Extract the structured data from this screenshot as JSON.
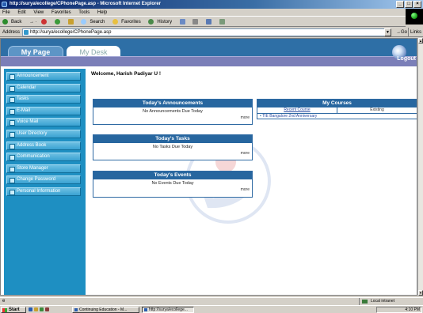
{
  "browser": {
    "title": "http://surya/ecollege/CPhonePage.asp - Microsoft Internet Explorer",
    "menu": [
      "File",
      "Edit",
      "View",
      "Favorites",
      "Tools",
      "Help"
    ],
    "toolbar": {
      "back": "Back",
      "search": "Search",
      "favorites": "Favorites",
      "history": "History"
    },
    "address_label": "Address",
    "address_url": "http://surya/ecollege/CPhonePage.asp",
    "go": "Go",
    "links": "Links"
  },
  "tabs": {
    "my_page": "My Page",
    "my_desk": "My Desk"
  },
  "logout": "Logout",
  "sidebar": {
    "items": [
      {
        "label": "Announcement"
      },
      {
        "label": "Calendar"
      },
      {
        "label": "Tasks"
      },
      {
        "label": "E-Mail"
      },
      {
        "label": "Voice Mail"
      },
      {
        "label": "User Directory"
      },
      {
        "label": "Address Book"
      },
      {
        "label": "Communication"
      },
      {
        "label": "Store Manager"
      },
      {
        "label": "Change Password"
      },
      {
        "label": "Personal Information"
      }
    ]
  },
  "welcome": "Welcome, Harish Padiyar U !",
  "announcements": {
    "title": "Today's Announcements",
    "empty": "No Announcements Due Today",
    "more": "more"
  },
  "tasks": {
    "title": "Today's Tasks",
    "empty": "No Tasks Due Today",
    "more": "more"
  },
  "events": {
    "title": "Today's Events",
    "empty": "No Events Due Today",
    "more": "more"
  },
  "courses": {
    "title": "My Courses",
    "col_recent": "Recent Course",
    "col_existing": "Existing",
    "items": [
      "TIE Bangalore 2nd Anniversary"
    ]
  },
  "status": {
    "zone": "Local intranet"
  },
  "taskbar": {
    "start": "Start",
    "task1": "Continuing Education - M...",
    "task2": "http://surya/ecollege...",
    "clock": "4:10 PM"
  }
}
